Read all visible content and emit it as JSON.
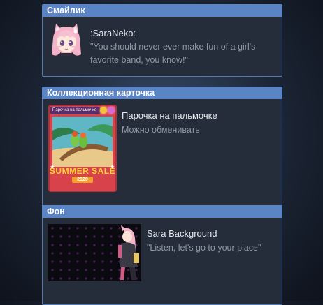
{
  "emoticon": {
    "header": "Смайлик",
    "code": ":SaraNeko:",
    "quote": "\"You should never ever make fun of a girl's favorite band, you know!\""
  },
  "card": {
    "header": "Коллекционная карточка",
    "name": "Парочка на пальмочке",
    "status": "Можно обменивать",
    "tag": "Парочка на пальмочке",
    "sale_text": "SUMMER SALE",
    "year": "2020"
  },
  "background": {
    "header": "Фон",
    "name": "Sara Background",
    "quote": "\"Listen, let's go to your place\""
  },
  "colors": {
    "header_bg": "#5b84c4",
    "panel_bg": "#252c3a",
    "border": "#5079b8",
    "title_text": "#e6e9ee",
    "sub_text": "#8f98a0"
  }
}
